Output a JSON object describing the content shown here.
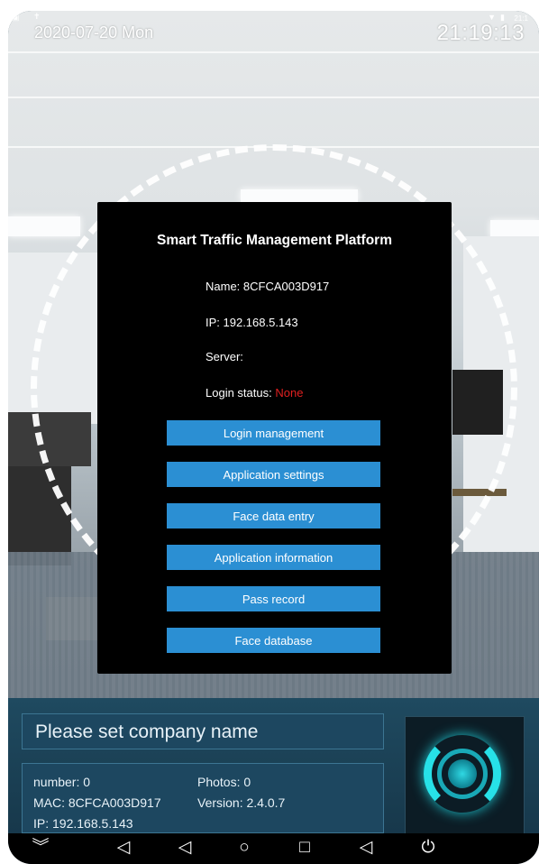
{
  "status_bar": {
    "date": "2020-07-20 Mon",
    "time": "21:19:13",
    "tiny_clock": "21:1"
  },
  "dialog": {
    "title": "Smart Traffic Management Platform",
    "name_line": "Name: 8CFCA003D917",
    "ip_line": "IP: 192.168.5.143",
    "server_line": "Server:",
    "login_status_label": "Login status:",
    "login_status_value": "None",
    "login_status_color": "#e02020",
    "buttons": [
      "Login management",
      "Application settings",
      "Face data entry",
      "Application information",
      "Pass record",
      "Face database"
    ],
    "button_color": "#2b8fd3"
  },
  "panel": {
    "company_name": "Please set company name",
    "number": "number: 0",
    "photos": "Photos: 0",
    "mac": "MAC: 8CFCA003D917",
    "version": "Version: 2.4.0.7",
    "ip": "IP: 192.168.5.143"
  },
  "nav_bar": {
    "icons": [
      "collapse-icon",
      "volume-down-icon",
      "back-icon",
      "home-icon",
      "recents-icon",
      "volume-up-icon",
      "power-icon"
    ]
  }
}
